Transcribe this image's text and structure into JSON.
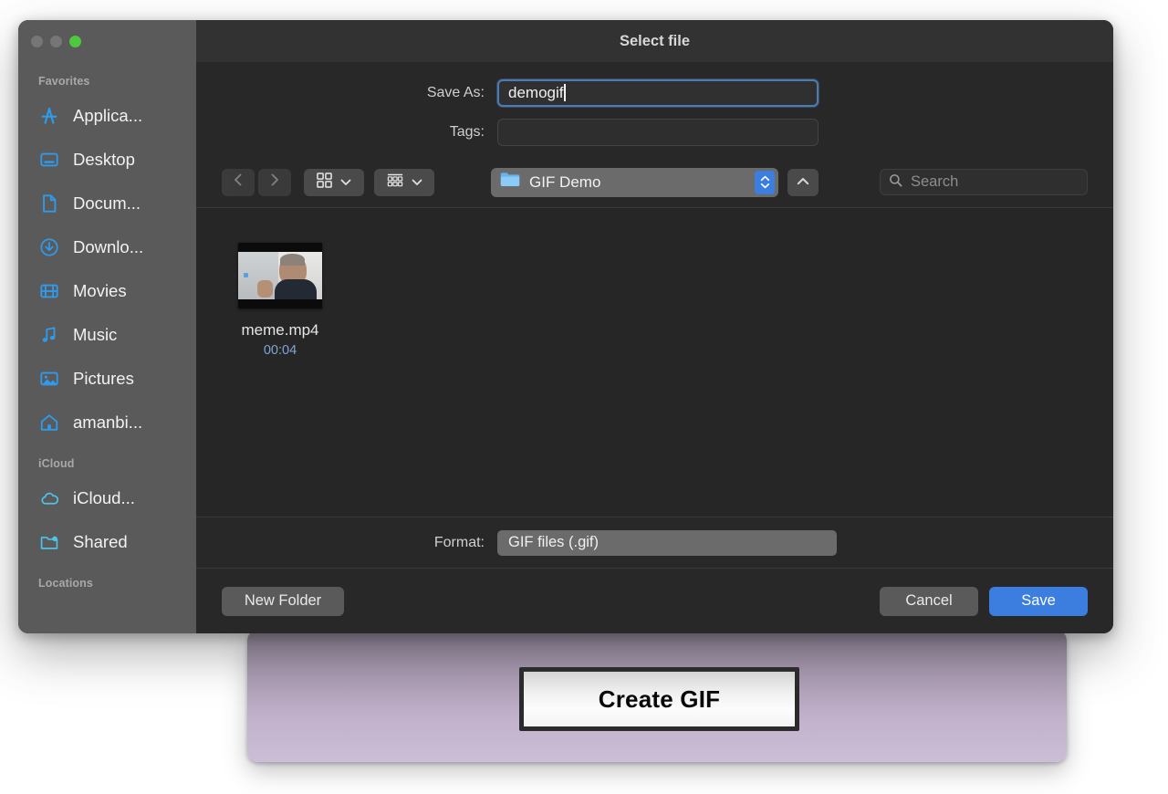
{
  "app_window": {
    "create_gif_label": "Create GIF",
    "panel_gradient_top": "#8d7f93",
    "panel_gradient_bottom": "#ccbed6"
  },
  "dialog": {
    "title": "Select file",
    "traffic_lights": {
      "close": "close-button",
      "minimize": "minimize-button",
      "zoom": "zoom-button",
      "zoom_color": "#4cc93f",
      "inactive_color": "#767676"
    },
    "fields": {
      "save_as_label": "Save As:",
      "save_as_value": "demogif",
      "tags_label": "Tags:",
      "tags_value": "",
      "tags_placeholder": ""
    },
    "toolbar": {
      "back_icon": "chevron-left-icon",
      "forward_icon": "chevron-right-icon",
      "icon_view_icon": "grid-view-icon",
      "list_view_icon": "list-view-icon",
      "path_folder_name": "GIF Demo",
      "path_stepper_icon": "stepper-up-down-icon",
      "up_button_icon": "chevron-up-icon",
      "search_icon": "search-icon",
      "search_placeholder": "Search",
      "search_value": "",
      "accent_color": "#3b7ee0"
    },
    "browser": {
      "files": [
        {
          "name": "meme.mp4",
          "meta": "00:04",
          "meta_color": "#7ea6d6",
          "thumb_icon": "video-thumbnail"
        }
      ]
    },
    "format": {
      "label": "Format:",
      "value": "GIF files (.gif)"
    },
    "buttons": {
      "new_folder": "New Folder",
      "cancel": "Cancel",
      "save": "Save"
    }
  },
  "sidebar": {
    "sections": [
      {
        "title": "Favorites",
        "items": [
          {
            "label": "Applica...",
            "icon": "applications-icon"
          },
          {
            "label": "Desktop",
            "icon": "desktop-icon"
          },
          {
            "label": "Docum...",
            "icon": "documents-icon"
          },
          {
            "label": "Downlo...",
            "icon": "downloads-icon"
          },
          {
            "label": "Movies",
            "icon": "movies-icon"
          },
          {
            "label": "Music",
            "icon": "music-icon"
          },
          {
            "label": "Pictures",
            "icon": "pictures-icon"
          },
          {
            "label": "amanbi...",
            "icon": "home-icon"
          }
        ]
      },
      {
        "title": "iCloud",
        "items": [
          {
            "label": "iCloud...",
            "icon": "icloud-icon"
          },
          {
            "label": "Shared",
            "icon": "shared-folder-icon"
          }
        ]
      },
      {
        "title": "Locations",
        "items": []
      }
    ]
  }
}
